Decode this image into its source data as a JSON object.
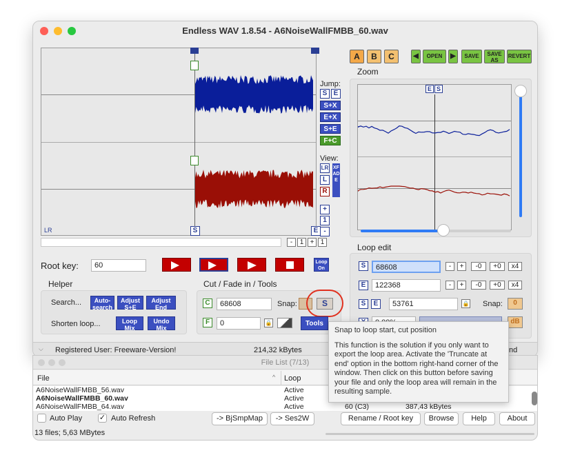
{
  "window": {
    "title": "Endless WAV 1.8.54 - A6NoiseWallFMBB_60.wav"
  },
  "wave": {
    "channel_tag": "LR",
    "marker_s": "S",
    "marker_e": "E",
    "zoom_values": [
      "-",
      "1",
      "+",
      "1"
    ]
  },
  "jump": {
    "label": "Jump:",
    "buttons": [
      "S",
      "E",
      "S+X",
      "E+X",
      "S+E",
      "F+C"
    ]
  },
  "view": {
    "label": "View:",
    "buttons": [
      "LR",
      "L",
      "R"
    ],
    "xfade": "XFADE",
    "zoom_buttons": [
      "+",
      "1",
      "-"
    ]
  },
  "presets": [
    "A",
    "B",
    "C"
  ],
  "file_buttons": [
    "OPEN",
    "SAVE",
    "SAVE AS",
    "REVERT"
  ],
  "zoom_panel": {
    "title": "Zoom",
    "markers": [
      "E",
      "S"
    ]
  },
  "root_key": {
    "label": "Root key:",
    "value": "60"
  },
  "transport": {
    "loop_on": "Loop On"
  },
  "helper": {
    "title": "Helper",
    "search_label": "Search...",
    "shorten_label": "Shorten loop...",
    "auto_search": "Auto-search",
    "adjust_se": "Adjust S+E",
    "adjust_end": "Adjust End",
    "loop_mix": "Loop Mix",
    "undo_mix": "Undo Mix"
  },
  "cut": {
    "title": "Cut / Fade in / Tools",
    "c_tag": "C",
    "c_value": "68608",
    "f_tag": "F",
    "f_value": "0",
    "snap_label": "Snap:",
    "snap_s": "S",
    "tools": "Tools"
  },
  "loop_edit": {
    "title": "Loop edit",
    "s_tag": "S",
    "s_value": "68608",
    "e_tag": "E",
    "e_value": "122368",
    "length_value": "53761",
    "snap_label": "Snap:",
    "minus": "-",
    "plus": "+",
    "minus0": "-0",
    "plus0": "+0",
    "x4": "x4",
    "snap_icon": "0",
    "percent_value": "0,00%",
    "x_tag": "X"
  },
  "status": {
    "registered": "Registered User: Freeware-Version!",
    "rate": "214,32 kBytes",
    "end_text": "nd"
  },
  "tooltip": {
    "title": "Snap to loop start, cut position",
    "body": "This function is the solution if you only want to export the loop area. Activate the 'Truncate at end' option in the bottom right-hand corner of the window. Then click on this button before saving your file and only the loop area will remain in the resulting sample."
  },
  "file_list": {
    "title": "File List (7/13)",
    "col_file": "File",
    "col_loop": "Loop",
    "rows": [
      {
        "file": "A6NoiseWallFMBB_56.wav",
        "loop": "Active",
        "key": "",
        "size": ""
      },
      {
        "file": "A6NoiseWallFMBB_60.wav",
        "loop": "Active",
        "key": "",
        "size": ""
      },
      {
        "file": "A6NoiseWallFMBB_64.wav",
        "loop": "Active",
        "key": "60 (C3)",
        "size": "387,43 kBytes"
      }
    ],
    "auto_play": "Auto Play",
    "auto_refresh": "Auto Refresh",
    "bjsmpmap": "-> BjSmpMap",
    "ses2w": "-> Ses2W",
    "rename": "Rename / Root key",
    "browse": "Browse",
    "help": "Help",
    "about": "About",
    "summary": "13 files; 5,63 MBytes"
  },
  "colors": {
    "left_wave": "#0a1e9a",
    "right_wave": "#9a0f06",
    "accent_blue": "#3b4fc0",
    "transport_red": "#c30000",
    "preset_orange": "#f3a848",
    "file_green": "#79c442",
    "highlight_circle": "#e0301e"
  }
}
